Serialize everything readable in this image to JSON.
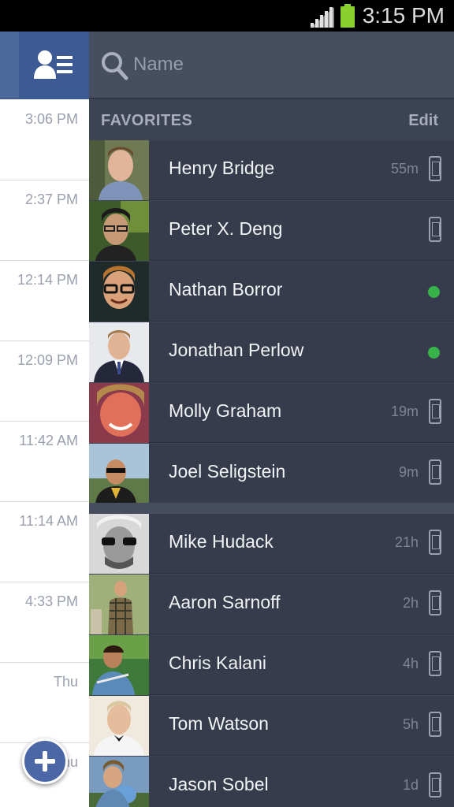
{
  "status_bar": {
    "time": "3:15 PM",
    "signal_icon": "signal-icon",
    "battery_icon": "battery-icon"
  },
  "left_panel": {
    "friends_button_icon": "friends-list-icon",
    "conversation_times": [
      "3:06 PM",
      "2:37 PM",
      "12:14 PM",
      "12:09 PM",
      "11:42 AM",
      "11:14 AM",
      "4:33 PM",
      "Thu",
      "Thu"
    ],
    "new_message_icon": "plus-icon"
  },
  "sidebar": {
    "search": {
      "placeholder": "Name",
      "icon": "search-icon"
    },
    "favorites_header": "FAVORITES",
    "edit_label": "Edit",
    "favorites": [
      {
        "name": "Henry Bridge",
        "ago": "55m",
        "status": "mobile"
      },
      {
        "name": "Peter X. Deng",
        "ago": "",
        "status": "mobile"
      },
      {
        "name": "Nathan Borror",
        "ago": "",
        "status": "online"
      },
      {
        "name": "Jonathan Perlow",
        "ago": "",
        "status": "online"
      },
      {
        "name": "Molly Graham",
        "ago": "19m",
        "status": "mobile"
      },
      {
        "name": "Joel Seligstein",
        "ago": "9m",
        "status": "mobile"
      }
    ],
    "others": [
      {
        "name": "Mike Hudack",
        "ago": "21h",
        "status": "mobile"
      },
      {
        "name": "Aaron Sarnoff",
        "ago": "2h",
        "status": "mobile"
      },
      {
        "name": "Chris Kalani",
        "ago": "4h",
        "status": "mobile"
      },
      {
        "name": "Tom Watson",
        "ago": "5h",
        "status": "mobile"
      },
      {
        "name": "Jason Sobel",
        "ago": "1d",
        "status": "mobile"
      }
    ]
  },
  "colors": {
    "online": "#37b34a",
    "facebook_blue": "#3d5a94",
    "sidebar_bg": "#363c4b"
  }
}
